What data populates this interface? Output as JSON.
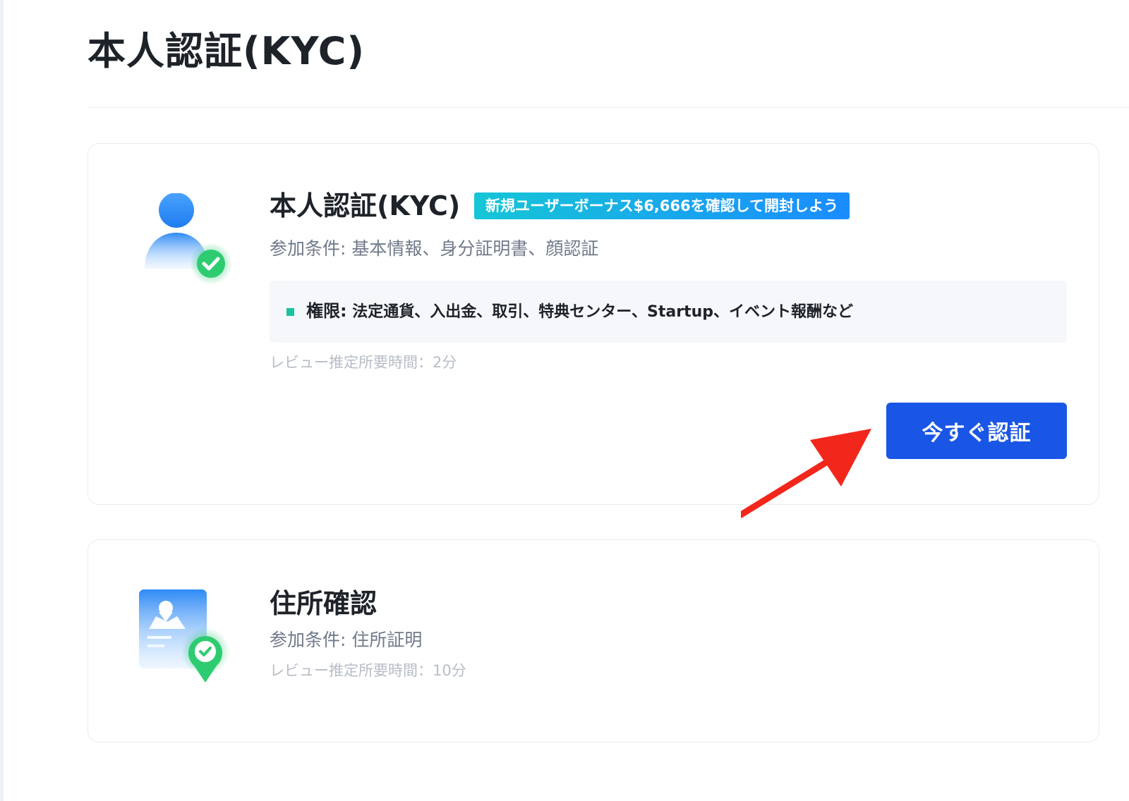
{
  "page": {
    "title": "本人認証(KYC)"
  },
  "kyc_card": {
    "title": "本人認証(KYC)",
    "bonus_badge": "新規ユーザーボーナス$6,666を確認して開封しよう",
    "requirements": "参加条件: 基本情報、身分証明書、顔認証",
    "permissions_label": "権限:",
    "permissions_value": " 法定通貨、入出金、取引、特典センター、Startup、イベント報酬など",
    "review_time": "レビュー推定所要時間：2分",
    "button_label": "今すぐ認証",
    "icon": "user-verified-icon"
  },
  "address_card": {
    "title": "住所確認",
    "requirements": "参加条件: 住所証明",
    "review_time": "レビュー推定所要時間：10分",
    "icon": "address-document-verified-icon"
  },
  "colors": {
    "primary_button": "#1a56e6",
    "badge_gradient_start": "#16c6d6",
    "badge_gradient_end": "#1a8cff",
    "check_green": "#2ecc71",
    "annotation_arrow": "#f2271b"
  }
}
